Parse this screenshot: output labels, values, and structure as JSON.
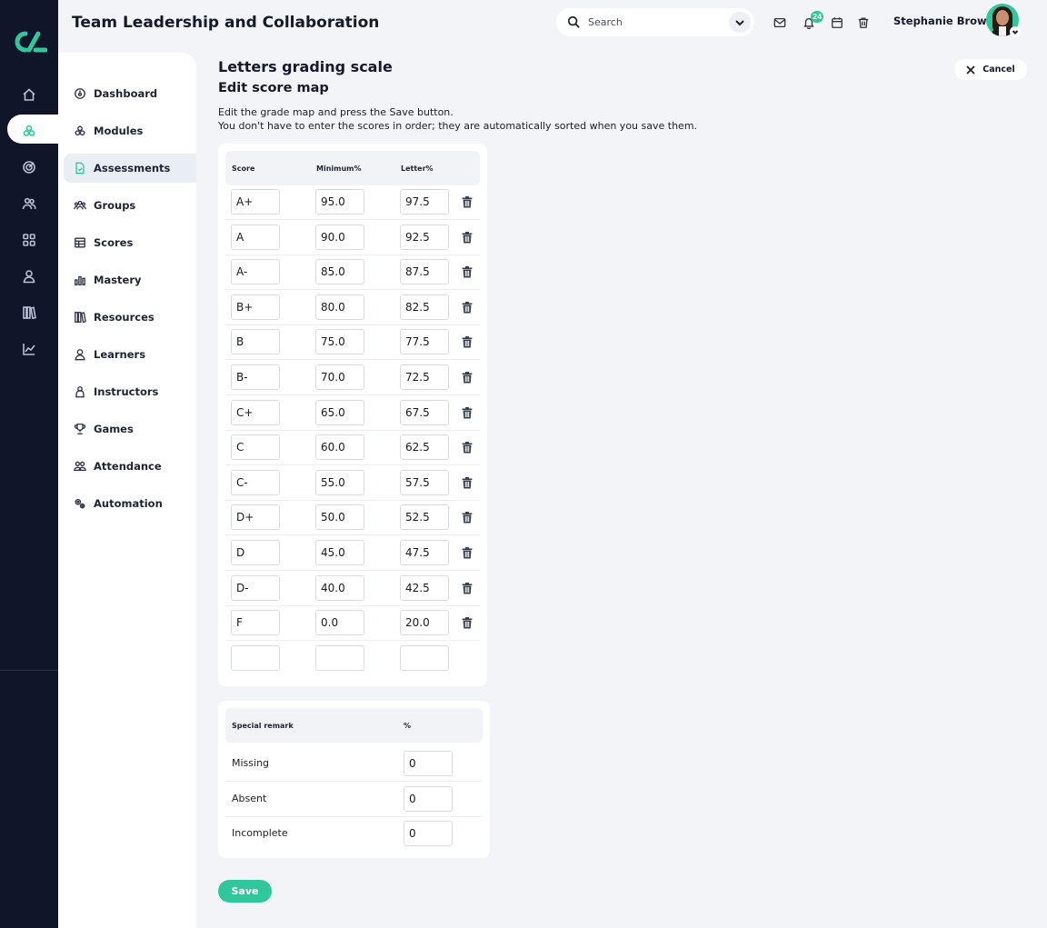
{
  "app": {
    "title": "Team Leadership and Collaboration"
  },
  "header": {
    "search_placeholder": "Search",
    "notification_count": "24",
    "user_name": "Stephanie Brown"
  },
  "rail_icons": [
    "home-icon",
    "modules-icon",
    "target-icon",
    "people-icon",
    "grid-icon",
    "person-icon",
    "books-icon",
    "chart-icon"
  ],
  "sidebar": {
    "items": [
      {
        "label": "Dashboard",
        "icon": "dashboard-icon"
      },
      {
        "label": "Modules",
        "icon": "modules-icon"
      },
      {
        "label": "Assessments",
        "icon": "assessments-icon",
        "active": true
      },
      {
        "label": "Groups",
        "icon": "groups-icon"
      },
      {
        "label": "Scores",
        "icon": "scores-icon"
      },
      {
        "label": "Mastery",
        "icon": "mastery-icon"
      },
      {
        "label": "Resources",
        "icon": "resources-icon"
      },
      {
        "label": "Learners",
        "icon": "learners-icon"
      },
      {
        "label": "Instructors",
        "icon": "instructors-icon"
      },
      {
        "label": "Games",
        "icon": "trophy-icon"
      },
      {
        "label": "Attendance",
        "icon": "attendance-icon"
      },
      {
        "label": "Automation",
        "icon": "gears-icon"
      }
    ]
  },
  "main": {
    "title": "Letters grading scale",
    "subtitle": "Edit score map",
    "instruction_1": "Edit the grade map and press the Save button.",
    "instruction_2": "You don't have to enter the scores in order; they are automatically sorted when you save them.",
    "cancel_label": "Cancel",
    "save_label": "Save"
  },
  "grade_table": {
    "headers": {
      "score": "Score",
      "minimum": "Minimum%",
      "letter": "Letter%"
    },
    "rows": [
      {
        "score": "A+",
        "minimum": "95.0",
        "letter": "97.5"
      },
      {
        "score": "A",
        "minimum": "90.0",
        "letter": "92.5"
      },
      {
        "score": "A-",
        "minimum": "85.0",
        "letter": "87.5"
      },
      {
        "score": "B+",
        "minimum": "80.0",
        "letter": "82.5"
      },
      {
        "score": "B",
        "minimum": "75.0",
        "letter": "77.5"
      },
      {
        "score": "B-",
        "minimum": "70.0",
        "letter": "72.5"
      },
      {
        "score": "C+",
        "minimum": "65.0",
        "letter": "67.5"
      },
      {
        "score": "C",
        "minimum": "60.0",
        "letter": "62.5"
      },
      {
        "score": "C-",
        "minimum": "55.0",
        "letter": "57.5"
      },
      {
        "score": "D+",
        "minimum": "50.0",
        "letter": "52.5"
      },
      {
        "score": "D",
        "minimum": "45.0",
        "letter": "47.5"
      },
      {
        "score": "D-",
        "minimum": "40.0",
        "letter": "42.5"
      },
      {
        "score": "F",
        "minimum": "0.0",
        "letter": "20.0"
      },
      {
        "score": "",
        "minimum": "",
        "letter": "",
        "empty": true
      }
    ]
  },
  "remark_table": {
    "headers": {
      "remark": "Special remark",
      "percent": "%"
    },
    "rows": [
      {
        "label": "Missing",
        "value": "0"
      },
      {
        "label": "Absent",
        "value": "0"
      },
      {
        "label": "Incomplete",
        "value": "0"
      }
    ]
  },
  "colors": {
    "accent": "#2fc79b",
    "rail": "#10152a",
    "background": "#f2f4f8"
  }
}
